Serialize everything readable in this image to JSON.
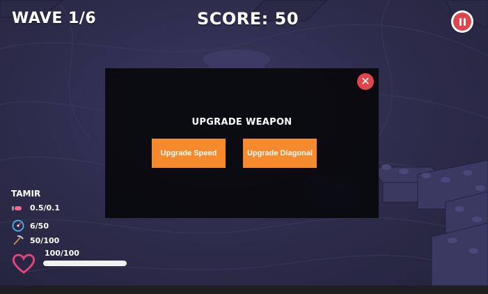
{
  "hud": {
    "wave_label": "WAVE 1/6",
    "score_label": "SCORE: 50"
  },
  "modal": {
    "title": "UPGRADE WEAPON",
    "close_symbol": "✕",
    "buttons": [
      {
        "label": "Upgrade Speed"
      },
      {
        "label": "Upgrade Diagonal"
      }
    ]
  },
  "player": {
    "name": "TAMIR",
    "stats": [
      {
        "icon": "bullet-icon",
        "value": "0.5/0.1"
      },
      {
        "icon": "speedometer-icon",
        "value": "6/50"
      },
      {
        "icon": "pickaxe-icon",
        "value": "50/100"
      }
    ],
    "health": {
      "label": "100/100",
      "fraction": 1.0
    }
  },
  "colors": {
    "accent_orange": "#f5892c",
    "danger_red": "#e0454c",
    "heart_pink": "#e0457a"
  }
}
